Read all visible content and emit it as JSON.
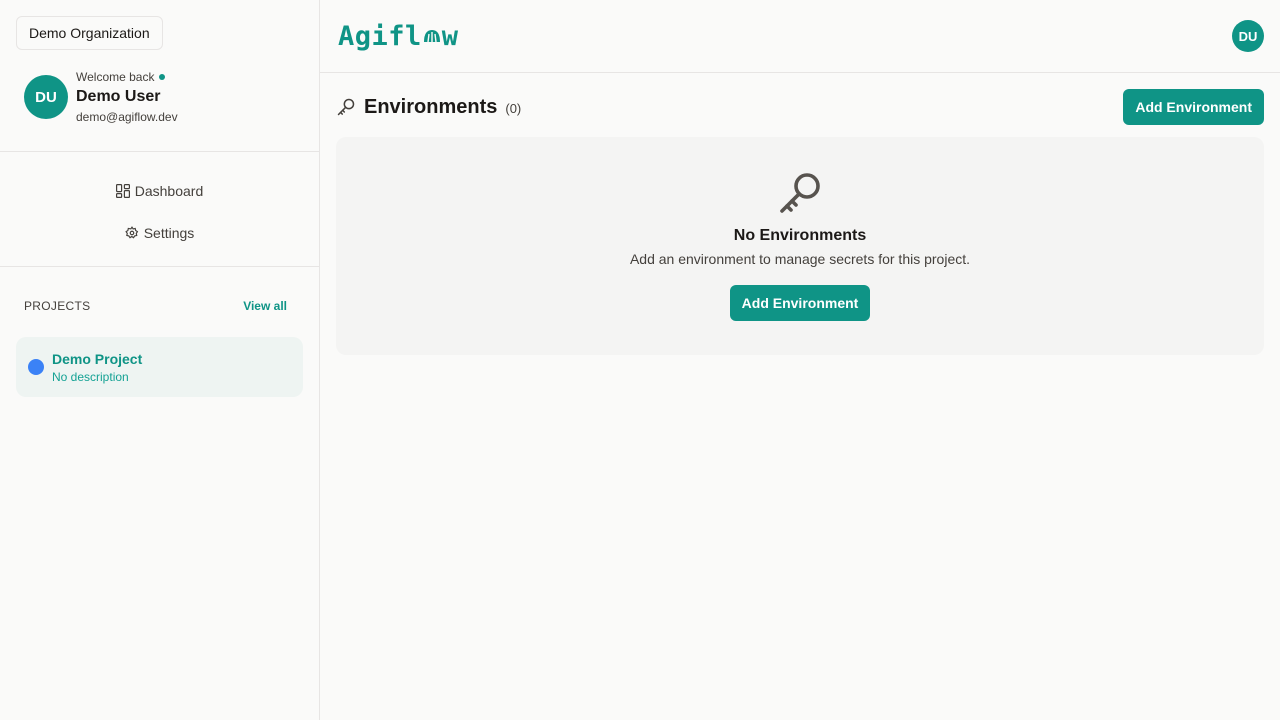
{
  "sidebar": {
    "organization": "Demo Organization",
    "user": {
      "initials": "DU",
      "welcome": "Welcome back",
      "name": "Demo User",
      "email": "demo@agiflow.dev"
    },
    "nav": [
      {
        "label": "Dashboard",
        "icon": "dashboard-icon"
      },
      {
        "label": "Settings",
        "icon": "gear-icon"
      }
    ],
    "projects": {
      "title": "PROJECTS",
      "view_all": "View all",
      "items": [
        {
          "name": "Demo Project",
          "description": "No description",
          "color": "#3b82f6"
        }
      ]
    }
  },
  "topbar": {
    "logo_left": "Agifl",
    "logo_right": "w",
    "avatar_initials": "DU"
  },
  "environments": {
    "title": "Environments",
    "count": "(0)",
    "add_button": "Add Environment",
    "empty": {
      "title": "No Environments",
      "subtitle": "Add an environment to manage secrets for this project.",
      "button": "Add Environment"
    }
  },
  "colors": {
    "accent": "#0f9486",
    "project_dot": "#3b82f6"
  }
}
